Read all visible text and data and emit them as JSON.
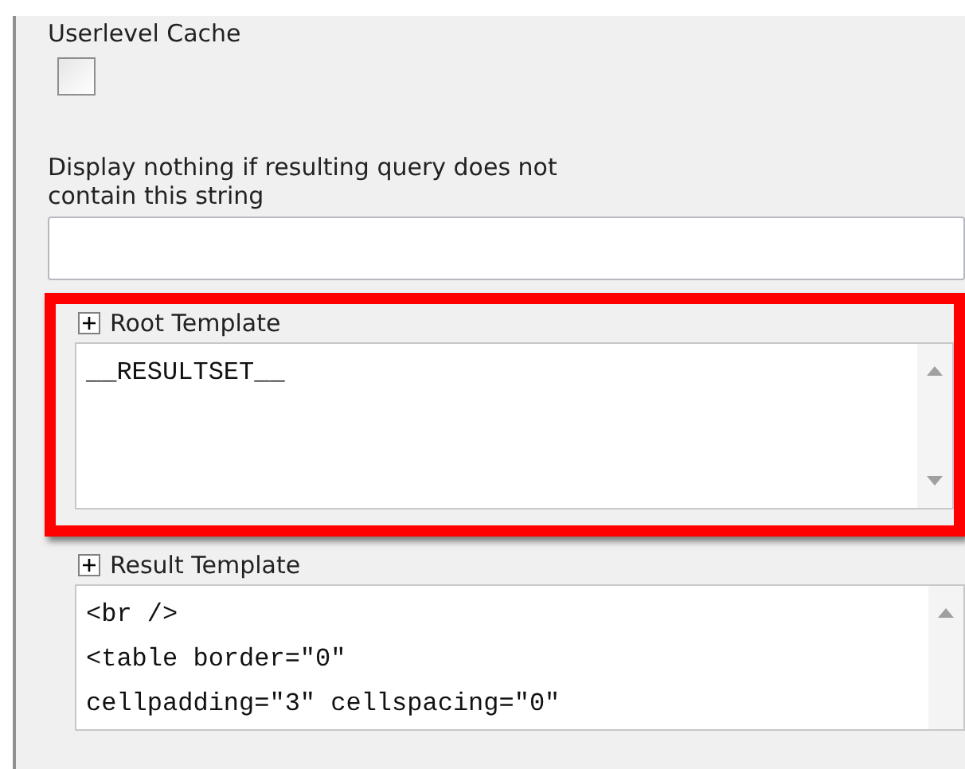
{
  "userlevel_cache": {
    "label": "Userlevel Cache",
    "checked": false
  },
  "filter_string": {
    "label": "Display nothing if resulting query does not contain this string"
  },
  "templates": [
    {
      "title": "Root Template",
      "expanded": false,
      "highlighted": true,
      "lines": [
        "__RESULTSET__"
      ]
    },
    {
      "title": "Result Template",
      "expanded": false,
      "highlighted": false,
      "lines": [
        "<br />",
        "<table border=\"0\"",
        "cellpadding=\"3\" cellspacing=\"0\""
      ]
    }
  ]
}
